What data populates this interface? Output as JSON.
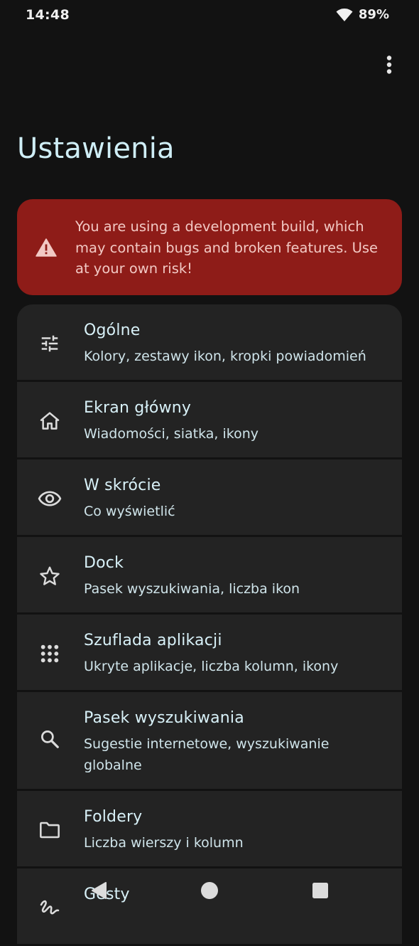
{
  "status_bar": {
    "time": "14:48",
    "battery": "89%"
  },
  "header": {
    "title": "Ustawienia"
  },
  "warning": {
    "text": "You are using a development build, which may contain bugs and broken features. Use at your own risk!"
  },
  "settings": {
    "items": [
      {
        "title": "Ogólne",
        "subtitle": "Kolory, zestawy ikon, kropki powiadomień",
        "icon": "tune-icon"
      },
      {
        "title": "Ekran główny",
        "subtitle": "Wiadomości, siatka, ikony",
        "icon": "home-icon"
      },
      {
        "title": "W skrócie",
        "subtitle": "Co wyświetlić",
        "icon": "eye-icon"
      },
      {
        "title": "Dock",
        "subtitle": "Pasek wyszukiwania, liczba ikon",
        "icon": "star-icon"
      },
      {
        "title": "Szuflada aplikacji",
        "subtitle": "Ukryte aplikacje, liczba kolumn, ikony",
        "icon": "app-grid-icon"
      },
      {
        "title": "Pasek wyszukiwania",
        "subtitle": "Sugestie internetowe, wyszukiwanie globalne",
        "icon": "search-icon"
      },
      {
        "title": "Foldery",
        "subtitle": "Liczba wierszy i kolumn",
        "icon": "folder-icon"
      },
      {
        "title": "Gesty",
        "subtitle": "",
        "icon": "gesture-icon"
      }
    ]
  },
  "colors": {
    "background": "#121212",
    "card": "#232323",
    "warning_bg": "#8e1c18",
    "title_accent": "#cfeef6"
  }
}
